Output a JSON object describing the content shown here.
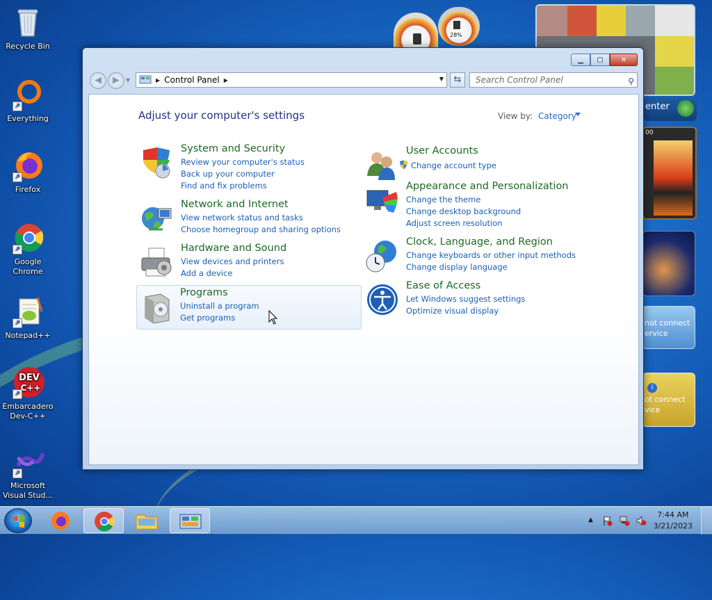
{
  "desktop": {
    "icons": [
      {
        "label": "Recycle Bin"
      },
      {
        "label": "Everything"
      },
      {
        "label": "Firefox"
      },
      {
        "label": "Google Chrome"
      },
      {
        "label": "Notepad++"
      },
      {
        "label": "Embarcadero Dev-C++"
      },
      {
        "label": "Microsoft Visual Stud..."
      }
    ]
  },
  "gadgets": {
    "meter_percent": "28%",
    "media_center_label": "enter",
    "weather_msg1": "not connect ervice",
    "weather_msg2": "ot connect vice",
    "puzzle_label": "00"
  },
  "window": {
    "address": {
      "crumb": "Control Panel"
    },
    "search_placeholder": "Search Control Panel",
    "heading": "Adjust your computer's settings",
    "view_by_label": "View by:",
    "view_by_value": "Category",
    "categories_left": [
      {
        "title": "System and Security",
        "links": [
          "Review your computer's status",
          "Back up your computer",
          "Find and fix problems"
        ]
      },
      {
        "title": "Network and Internet",
        "links": [
          "View network status and tasks",
          "Choose homegroup and sharing options"
        ]
      },
      {
        "title": "Hardware and Sound",
        "links": [
          "View devices and printers",
          "Add a device"
        ]
      },
      {
        "title": "Programs",
        "links": [
          "Uninstall a program",
          "Get programs"
        ]
      }
    ],
    "categories_right": [
      {
        "title": "User Accounts",
        "links": [
          "Change account type"
        ]
      },
      {
        "title": "Appearance and Personalization",
        "links": [
          "Change the theme",
          "Change desktop background",
          "Adjust screen resolution"
        ]
      },
      {
        "title": "Clock, Language, and Region",
        "links": [
          "Change keyboards or other input methods",
          "Change display language"
        ]
      },
      {
        "title": "Ease of Access",
        "links": [
          "Let Windows suggest settings",
          "Optimize visual display"
        ]
      }
    ]
  },
  "taskbar": {
    "time": "7:44 AM",
    "date": "3/21/2023"
  }
}
